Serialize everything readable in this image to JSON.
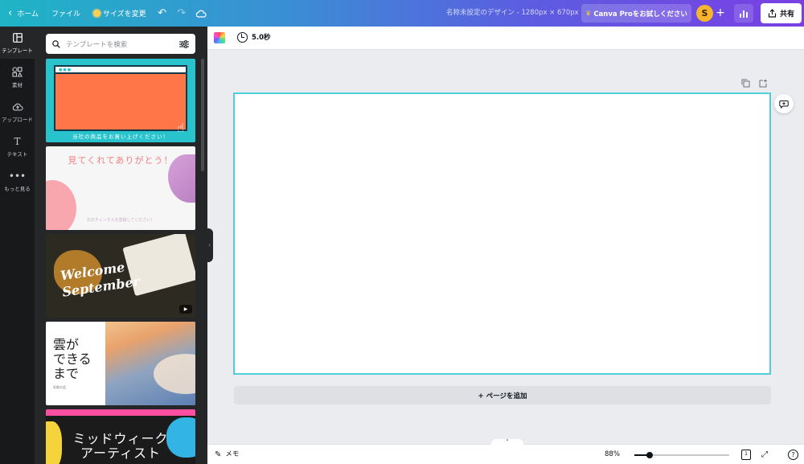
{
  "topbar": {
    "back_label": "ホーム",
    "file_label": "ファイル",
    "resize_label": "サイズを変更",
    "doc_title": "名称未設定のデザイン - 1280px × 670px",
    "pro_label": "Canva Proをお試しください",
    "avatar_initial": "S",
    "share_label": "共有"
  },
  "rail": {
    "items": [
      {
        "label": "テンプレート",
        "icon": "template-icon"
      },
      {
        "label": "素材",
        "icon": "elements-icon"
      },
      {
        "label": "アップロード",
        "icon": "upload-icon"
      },
      {
        "label": "テキスト",
        "icon": "text-icon"
      },
      {
        "label": "もっと見る",
        "icon": "more-icon"
      }
    ]
  },
  "panel": {
    "search_placeholder": "テンプレートを検索",
    "templates": [
      {
        "caption": "当社の商品をお買い上げください！"
      },
      {
        "title": "見てくれてありがとう！",
        "sub": "次のチャンネルを登録してください！"
      },
      {
        "line1": "Welcome",
        "line2": "September"
      },
      {
        "text": "雲が\nできる\nまで",
        "small": "気象の話"
      },
      {
        "text": "ミッドウィーク\nアーティスト"
      }
    ]
  },
  "editor": {
    "duration": "5.0秒",
    "add_page_label": "+ ページを追加"
  },
  "bottombar": {
    "memo_label": "メモ",
    "zoom_label": "88%",
    "zoom_value": 0.16,
    "page_count": "1",
    "help_label": "?"
  },
  "colors": {
    "accent": "#4fd0d9",
    "rail_bg": "#18191b",
    "panel_bg": "#252627",
    "canvas_bg": "#ebecf0"
  }
}
